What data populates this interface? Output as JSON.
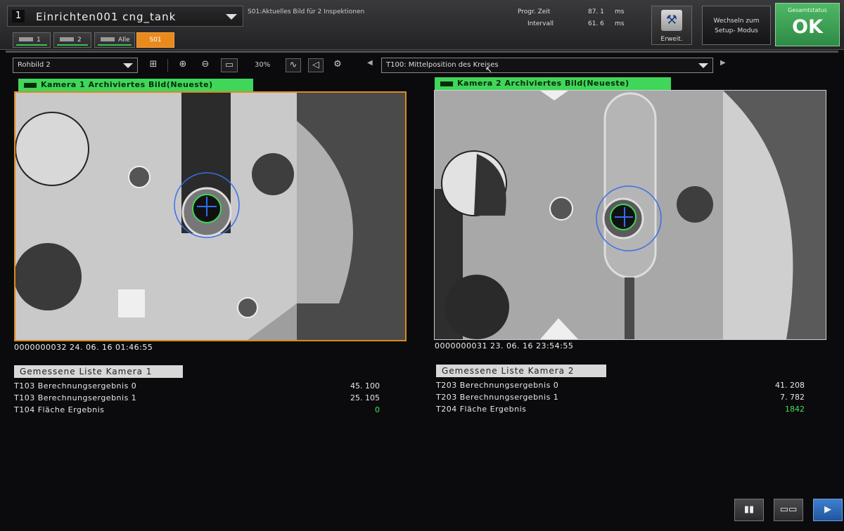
{
  "header": {
    "scene_number": "1",
    "scene_name": "Einrichten001 cng_tank",
    "inspection_message": "S01:Aktuelles Bild für 2 Inspektionen",
    "progr_zeit_label": "Progr. Zeit",
    "progr_zeit_value": "87. 1",
    "progr_zeit_unit": "ms",
    "intervall_label": "Intervall",
    "intervall_value": "61. 6",
    "intervall_unit": "ms",
    "erweit_label": "Erweit.",
    "setup_line1": "Wechseln zum",
    "setup_line2": "Setup- Modus",
    "status_title": "Gesamtstatus",
    "status_value": "OK"
  },
  "tabs": [
    {
      "label": "1"
    },
    {
      "label": "2"
    },
    {
      "label": "Alle"
    },
    {
      "label": "S01"
    }
  ],
  "toolbar": {
    "image_mode": "Rohbild 2",
    "zoom": "30%",
    "tool_select": "T100: Mittelposition des Kreises"
  },
  "camera1": {
    "label": "Kamera 1 Archiviertes Bild(Neueste)",
    "stamp": "0000000032 24. 06. 16 01:46:55",
    "list_title": "Gemessene Liste Kamera 1",
    "rows": [
      {
        "name": "T103 Berechnungsergebnis 0",
        "value": "45. 100"
      },
      {
        "name": "T103 Berechnungsergebnis 1",
        "value": "25. 105"
      },
      {
        "name": "T104 Fläche Ergebnis",
        "value": "0"
      }
    ]
  },
  "camera2": {
    "label": "Kamera 2 Archiviertes Bild(Neueste)",
    "stamp": "0000000031 23. 06. 16 23:54:55",
    "list_title": "Gemessene Liste Kamera 2",
    "rows": [
      {
        "name": "T203 Berechnungsergebnis 0",
        "value": "41. 208"
      },
      {
        "name": "T203 Berechnungsergebnis 1",
        "value": "7. 782"
      },
      {
        "name": "T204 Fläche Ergebnis",
        "value": "1842"
      }
    ]
  },
  "colors": {
    "ok_green": "#3fb556",
    "label_green": "#3fd65a",
    "active_tab": "#e98a1d",
    "frame_orange": "#d98a1f"
  },
  "icons": [
    "layout-icon",
    "zoom-in-icon",
    "zoom-out-icon",
    "fit-icon",
    "graph-icon",
    "edit-icon",
    "settings-icon",
    "chart-icon",
    "list-icon",
    "play-icon"
  ]
}
